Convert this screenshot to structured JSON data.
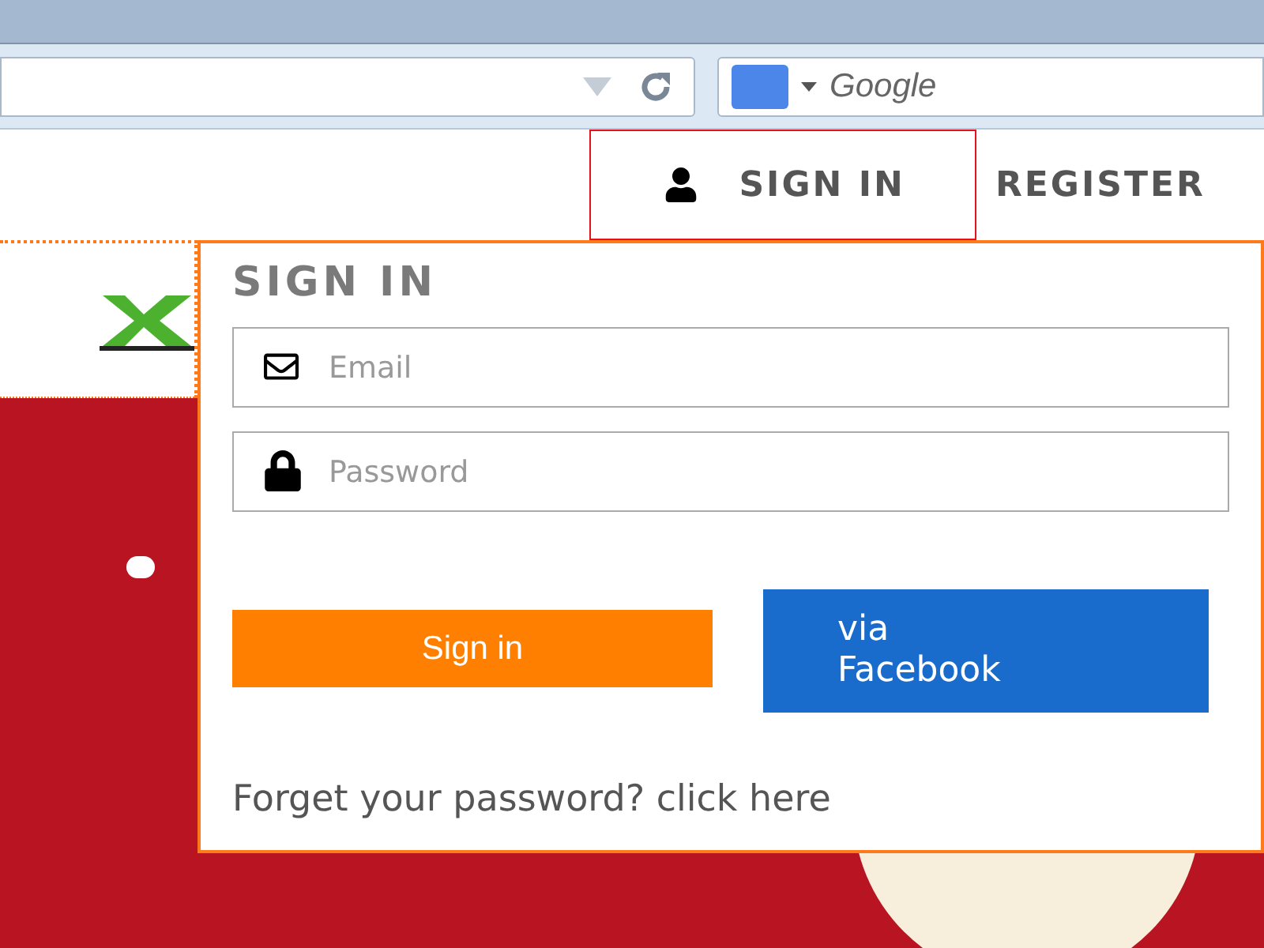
{
  "browser": {
    "search_placeholder": "Google"
  },
  "nav": [
    {
      "label": "SIGN IN",
      "selected": true
    },
    {
      "label": "REGISTER",
      "selected": false
    }
  ],
  "sign_in_panel": {
    "title": "SIGN IN",
    "email_placeholder": "Email",
    "password_placeholder": "Password",
    "sign_in_button": "Sign in",
    "facebook_button": "via Facebook",
    "forgot_text": "Forget your password? click here"
  }
}
